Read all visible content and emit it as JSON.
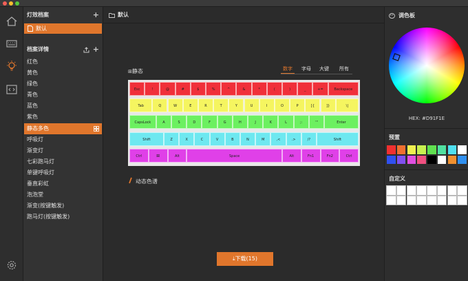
{
  "left_panel": {
    "files_header": "灯效档案",
    "file_item": "默认",
    "details_header": "档案详情",
    "effects": [
      "红色",
      "黄色",
      "绿色",
      "青色",
      "蓝色",
      "紫色",
      "静态多色",
      "呼吸灯",
      "渐变灯",
      "七彩跑马灯",
      "单键呼吸灯",
      "垂直彩虹",
      "泡泡堂",
      "渐变(按键触发)",
      "跑马灯(按键触发)"
    ],
    "active_effect": "静态多色"
  },
  "main": {
    "title": "默认",
    "mode_label": "静态",
    "tabs": [
      "数字",
      "字母",
      "大键",
      "所有"
    ],
    "active_tab": "数字",
    "dynamic_label": "动态色谱",
    "download_label": "下载(15)"
  },
  "keyboard": {
    "rows": [
      {
        "color": "#f0303a",
        "keys": [
          {
            "label": "Esc",
            "w": 1
          },
          {
            "label": "!",
            "w": 1
          },
          {
            "label": "@",
            "w": 1
          },
          {
            "label": "#",
            "w": 1
          },
          {
            "label": "$",
            "w": 1
          },
          {
            "label": "%",
            "w": 1
          },
          {
            "label": "^",
            "w": 1
          },
          {
            "label": "&",
            "w": 1
          },
          {
            "label": "*",
            "w": 1
          },
          {
            "label": "(",
            "w": 1
          },
          {
            "label": ")",
            "w": 1
          },
          {
            "label": "_",
            "w": 1
          },
          {
            "label": "+=",
            "w": 1
          },
          {
            "label": "Backspace",
            "w": 2
          }
        ]
      },
      {
        "color": "#f5f560",
        "keys": [
          {
            "label": "Tab",
            "w": 1.5
          },
          {
            "label": "Q",
            "w": 1
          },
          {
            "label": "W",
            "w": 1
          },
          {
            "label": "E",
            "w": 1
          },
          {
            "label": "R",
            "w": 1
          },
          {
            "label": "T",
            "w": 1
          },
          {
            "label": "Y",
            "w": 1
          },
          {
            "label": "U",
            "w": 1
          },
          {
            "label": "I",
            "w": 1
          },
          {
            "label": "O",
            "w": 1
          },
          {
            "label": "P",
            "w": 1
          },
          {
            "label": "[{",
            "w": 1
          },
          {
            "label": "]}",
            "w": 1
          },
          {
            "label": "\\|",
            "w": 1.5
          }
        ]
      },
      {
        "color": "#6cf060",
        "keys": [
          {
            "label": "CapsLock",
            "w": 1.75
          },
          {
            "label": "A",
            "w": 1
          },
          {
            "label": "S",
            "w": 1
          },
          {
            "label": "D",
            "w": 1
          },
          {
            "label": "F",
            "w": 1
          },
          {
            "label": "G",
            "w": 1
          },
          {
            "label": "H",
            "w": 1
          },
          {
            "label": "J",
            "w": 1
          },
          {
            "label": "K",
            "w": 1
          },
          {
            "label": "L",
            "w": 1
          },
          {
            "label": ";:",
            "w": 1
          },
          {
            "label": "'\"",
            "w": 1
          },
          {
            "label": "Enter",
            "w": 2.25
          }
        ]
      },
      {
        "color": "#6ee8f0",
        "keys": [
          {
            "label": "Shift",
            "w": 2.25
          },
          {
            "label": "Z",
            "w": 1
          },
          {
            "label": "X",
            "w": 1
          },
          {
            "label": "C",
            "w": 1
          },
          {
            "label": "V",
            "w": 1
          },
          {
            "label": "B",
            "w": 1
          },
          {
            "label": "N",
            "w": 1
          },
          {
            "label": "M",
            "w": 1
          },
          {
            "label": ",<",
            "w": 1
          },
          {
            "label": ".>",
            "w": 1
          },
          {
            "label": "/?",
            "w": 1
          },
          {
            "label": "Shift",
            "w": 2.75
          }
        ]
      },
      {
        "color": "#e040e8",
        "keys": [
          {
            "label": "Ctrl",
            "w": 1.25
          },
          {
            "label": "Win",
            "w": 1.25
          },
          {
            "label": "Alt",
            "w": 1.25
          },
          {
            "label": "Space",
            "w": 6.25
          },
          {
            "label": "Alt",
            "w": 1.25
          },
          {
            "label": "Fn1",
            "w": 1.25
          },
          {
            "label": "Fn2",
            "w": 1.25
          },
          {
            "label": "Ctrl",
            "w": 1.25
          }
        ]
      }
    ]
  },
  "right_panel": {
    "palette_header": "调色板",
    "hex_label": "HEX: #D91F1E",
    "presets_header": "预置",
    "presets": [
      "#f03030",
      "#f07030",
      "#f0f050",
      "#c8f050",
      "#60e050",
      "#50e0a0",
      "#50e0f0",
      "#ffffff",
      "#3050f0",
      "#8050f0",
      "#e050e0",
      "#f05080",
      "#000000",
      "#ffffff",
      "#f09030",
      "#3090f0"
    ],
    "custom_header": "自定义",
    "custom_count": 16
  },
  "colors": {
    "accent": "#e0762c"
  }
}
